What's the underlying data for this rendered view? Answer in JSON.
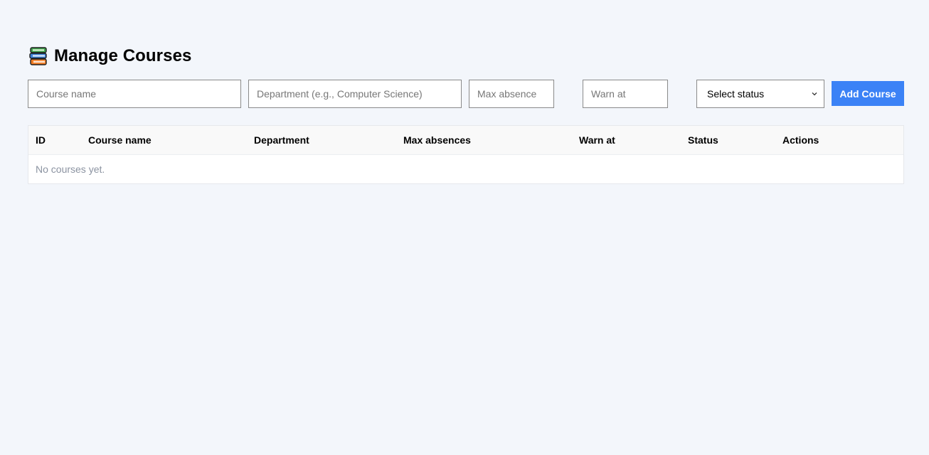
{
  "header": {
    "icon": "books-icon",
    "title": "Manage Courses"
  },
  "form": {
    "course_name_placeholder": "Course name",
    "department_placeholder": "Department (e.g., Computer Science)",
    "max_absence_placeholder": "Max absence",
    "warn_at_placeholder": "Warn at",
    "status_select_value": "Select status",
    "add_button_label": "Add Course",
    "accent_color": "#3b82f6"
  },
  "table": {
    "columns": [
      "ID",
      "Course name",
      "Department",
      "Max absences",
      "Warn at",
      "Status",
      "Actions"
    ],
    "empty_message": "No courses yet."
  }
}
